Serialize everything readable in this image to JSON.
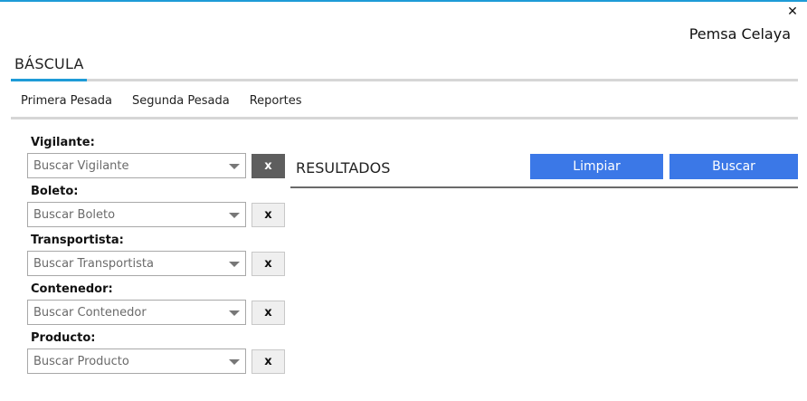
{
  "window": {
    "close_glyph": "✕"
  },
  "header": {
    "company": "Pemsa Celaya",
    "app_title": "BÁSCULA"
  },
  "tabs": [
    {
      "label": "Primera Pesada",
      "active": false
    },
    {
      "label": "Segunda Pesada",
      "active": false
    },
    {
      "label": "Reportes",
      "active": true
    }
  ],
  "filters": [
    {
      "label": "Vigilante:",
      "placeholder": "Buscar Vigilante",
      "clear_label": "x"
    },
    {
      "label": "Boleto:",
      "placeholder": "Buscar Boleto",
      "clear_label": "x"
    },
    {
      "label": "Transportista:",
      "placeholder": "Buscar Transportista",
      "clear_label": "x"
    },
    {
      "label": "Contenedor:",
      "placeholder": "Buscar Contenedor",
      "clear_label": "x"
    },
    {
      "label": "Producto:",
      "placeholder": "Buscar Producto",
      "clear_label": "x"
    }
  ],
  "results": {
    "title": "RESULTADOS"
  },
  "actions": {
    "clear_label": "Limpiar",
    "search_label": "Buscar"
  },
  "colors": {
    "accent": "#1e9bd7",
    "button": "#3b78e7"
  }
}
